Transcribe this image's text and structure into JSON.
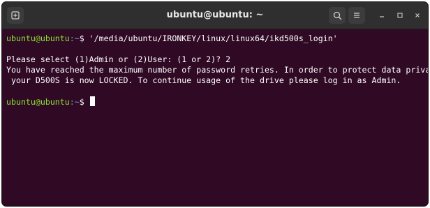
{
  "window": {
    "title": "ubuntu@ubuntu: ~"
  },
  "terminal": {
    "prompt_user": "ubuntu@ubuntu",
    "prompt_path": ":~",
    "prompt_symbol": "$",
    "command": " '/media/ubuntu/IRONKEY/linux/linux64/ikd500s_login'",
    "output": [
      "Please select (1)Admin or (2)User: (1 or 2)? 2",
      "You have reached the maximum number of password retries. In order to protect data privacy,",
      " your D500S is now LOCKED. To continue usage of the drive please log in as Admin."
    ]
  },
  "colors": {
    "terminal_bg": "#300a24",
    "prompt_user": "#8ae234",
    "prompt_path": "#729fcf",
    "titlebar_bg": "#302f30"
  },
  "icons": {
    "new_tab": "new-tab-icon",
    "search": "search-icon",
    "menu": "hamburger-menu-icon",
    "minimize": "minimize-icon",
    "maximize": "maximize-icon",
    "close": "close-icon"
  }
}
